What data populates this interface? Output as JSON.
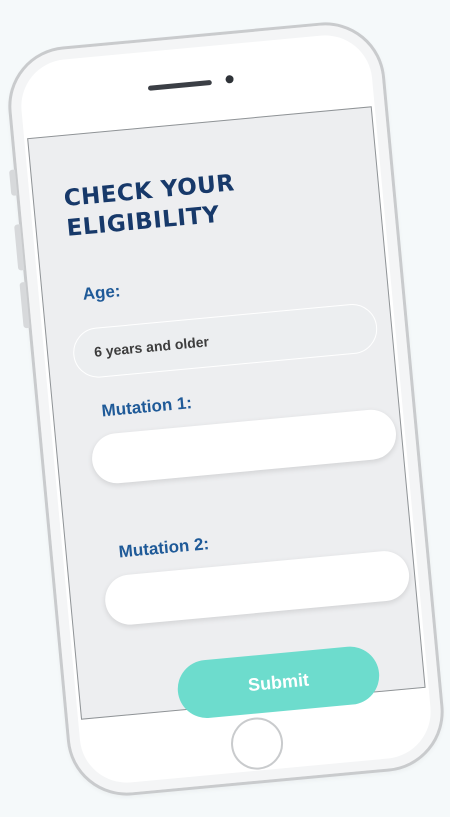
{
  "form": {
    "title": "CHECK YOUR\nELIGIBILITY",
    "age_label": "Age:",
    "age_value": "6 years and older",
    "mutation1_label": "Mutation 1:",
    "mutation1_value": "",
    "mutation2_label": "Mutation 2:",
    "mutation2_value": "",
    "submit_label": "Submit"
  },
  "colors": {
    "title": "#17396a",
    "label": "#1f5a98",
    "screen_bg": "#edeef0",
    "submit_bg": "#6ddccd",
    "page_bg": "#f5f9fa"
  },
  "icons": {
    "home_button": "home-button-icon",
    "speaker": "speaker-icon",
    "camera": "camera-icon"
  }
}
